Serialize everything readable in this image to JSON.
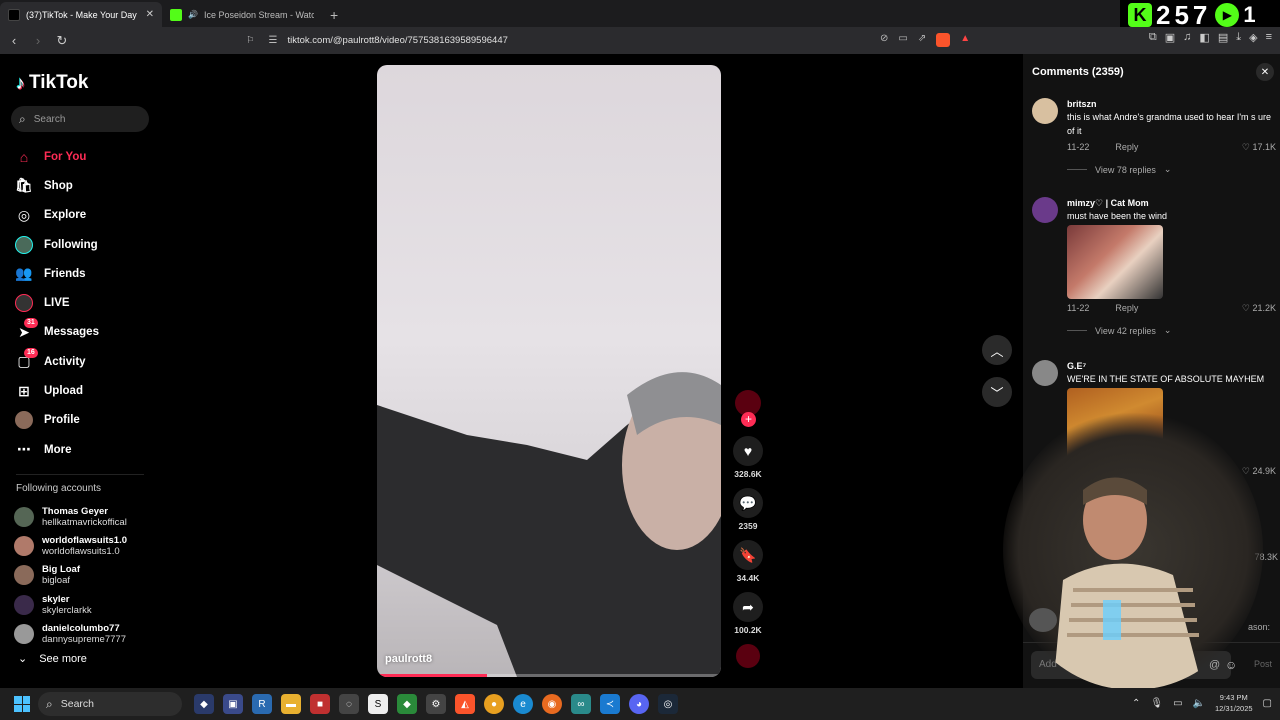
{
  "browser": {
    "tabs": [
      {
        "title": "(37)TikTok - Make Your Day",
        "active": true,
        "favicon_color": "#000000"
      },
      {
        "title": "Ice Poseidon Stream - Watch Live",
        "active": false,
        "favicon_color": "#53fc18"
      }
    ],
    "url": "tiktok.com/@paulrott8/video/7575381639589596447"
  },
  "kick_widget": {
    "badge": "K",
    "count": "257",
    "extra": "1"
  },
  "sidebar": {
    "logo": "TikTok",
    "search_placeholder": "Search",
    "nav": [
      {
        "label": "For You",
        "icon": "home-icon",
        "active": true
      },
      {
        "label": "Shop",
        "icon": "shop-icon"
      },
      {
        "label": "Explore",
        "icon": "compass-icon"
      },
      {
        "label": "Following",
        "icon": "following-avatar-icon"
      },
      {
        "label": "Friends",
        "icon": "friends-icon"
      },
      {
        "label": "LIVE",
        "icon": "live-icon"
      },
      {
        "label": "Messages",
        "icon": "messages-icon",
        "badge": "31"
      },
      {
        "label": "Activity",
        "icon": "activity-icon",
        "badge": "16"
      },
      {
        "label": "Upload",
        "icon": "upload-icon"
      },
      {
        "label": "Profile",
        "icon": "profile-avatar-icon"
      },
      {
        "label": "More",
        "icon": "more-icon"
      }
    ],
    "following_title": "Following accounts",
    "following": [
      {
        "name": "Thomas Geyer",
        "handle": "hellkatmavrickoffical",
        "color": "#556655"
      },
      {
        "name": "worldoflawsuits1.0",
        "handle": "worldoflawsuits1.0",
        "color": "#b07a6a"
      },
      {
        "name": "Big Loaf",
        "handle": "bigloaf",
        "color": "#8a6a5a"
      },
      {
        "name": "skyler",
        "handle": "skylerclarkk",
        "color": "#3a2a4a"
      },
      {
        "name": "danielcolumbo77",
        "handle": "dannysupreme7777",
        "color": "#999999"
      }
    ],
    "see_more": "See more"
  },
  "video": {
    "author": "paulrott8",
    "progress_fraction": 0.32,
    "likes": "328.6K",
    "comments": "2359",
    "saves": "34.4K",
    "shares": "100.2K"
  },
  "comments_panel": {
    "title": "Comments (2359)",
    "items": [
      {
        "user": "britszn",
        "text": "this is what Andre's grandma used to hear I'm s ure of it",
        "date": "11-22",
        "reply": "Reply",
        "likes": "17.1K",
        "replies": "View 78 replies",
        "avatar_color": "#d8c0a0"
      },
      {
        "user": "mimzy♡ | Cat Mom",
        "text": "must have been the wind",
        "date": "11-22",
        "reply": "Reply",
        "likes": "21.2K",
        "replies": "View 42 replies",
        "avatar_color": "#6a3a8a"
      },
      {
        "user": "G.E⁷",
        "text": "WE'RE IN THE STATE OF ABSOLUTE MAYHEM",
        "likes": "24.9K",
        "avatar_color": "#888888"
      }
    ],
    "hidden_likes": "78.3K",
    "partial_text": "ason:",
    "input_placeholder": "Add comment...",
    "post": "Post"
  },
  "taskbar": {
    "search": "Search",
    "time": "9:43 PM",
    "date": "12/31/2025"
  },
  "colors": {
    "accent": "#fe2c55",
    "kick": "#53fc18"
  }
}
